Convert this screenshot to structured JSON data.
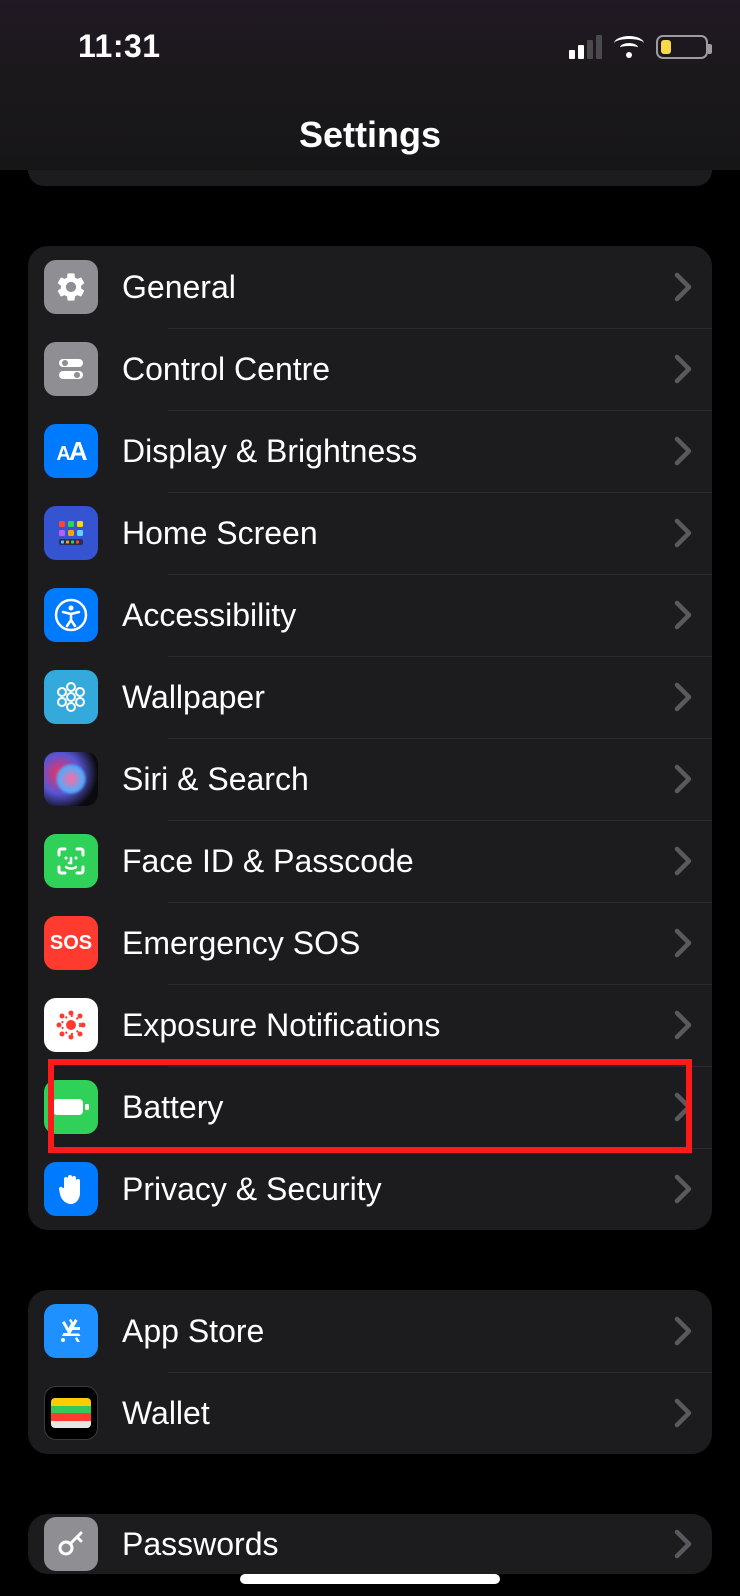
{
  "status": {
    "time": "11:31"
  },
  "title": "Settings",
  "groups": [
    {
      "id": "g1",
      "items": [
        {
          "key": "general",
          "label": "General",
          "icon": "gear-icon"
        },
        {
          "key": "cc",
          "label": "Control Centre",
          "icon": "toggles-icon"
        },
        {
          "key": "display",
          "label": "Display & Brightness",
          "icon": "textsize-icon"
        },
        {
          "key": "home",
          "label": "Home Screen",
          "icon": "app-grid-icon"
        },
        {
          "key": "access",
          "label": "Accessibility",
          "icon": "accessibility-icon"
        },
        {
          "key": "wall",
          "label": "Wallpaper",
          "icon": "flower-icon"
        },
        {
          "key": "siri",
          "label": "Siri & Search",
          "icon": "siri-icon"
        },
        {
          "key": "face",
          "label": "Face ID & Passcode",
          "icon": "faceid-icon"
        },
        {
          "key": "sos",
          "label": "Emergency SOS",
          "icon": "sos-icon"
        },
        {
          "key": "expo",
          "label": "Exposure Notifications",
          "icon": "exposure-icon"
        },
        {
          "key": "batt",
          "label": "Battery",
          "icon": "battery-icon",
          "highlighted": true
        },
        {
          "key": "priv",
          "label": "Privacy & Security",
          "icon": "hand-icon"
        }
      ]
    },
    {
      "id": "g2",
      "items": [
        {
          "key": "store",
          "label": "App Store",
          "icon": "appstore-icon"
        },
        {
          "key": "wallet",
          "label": "Wallet",
          "icon": "wallet-icon"
        }
      ]
    },
    {
      "id": "g3",
      "items": [
        {
          "key": "pass",
          "label": "Passwords",
          "icon": "key-icon"
        }
      ]
    }
  ],
  "sos_text": "SOS"
}
